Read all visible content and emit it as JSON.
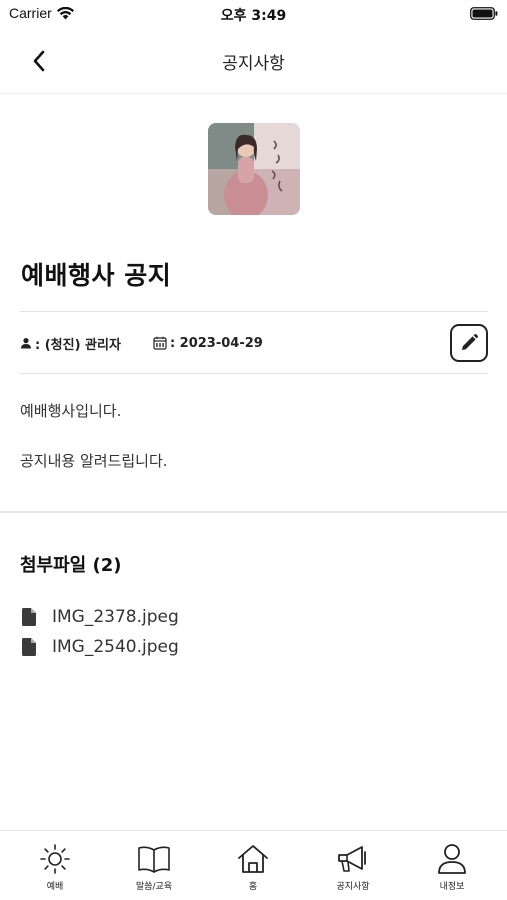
{
  "status_bar": {
    "carrier": "Carrier",
    "time": "오후 3:49"
  },
  "nav": {
    "title": "공지사항",
    "back_icon": "chevron-left-icon"
  },
  "post": {
    "title": "예배행사 공지",
    "author_label": ": (청진) 관리자",
    "date_label": ": 2023-04-29",
    "body_lines": [
      "예배행사입니다.",
      "공지내용 알려드립니다."
    ]
  },
  "attachments": {
    "heading": "첨부파일 (2)",
    "files": [
      "IMG_2378.jpeg",
      "IMG_2540.jpeg"
    ]
  },
  "tabs": [
    {
      "label": "예배",
      "icon": "sun-icon"
    },
    {
      "label": "말씀/교육",
      "icon": "book-icon"
    },
    {
      "label": "홈",
      "icon": "home-icon"
    },
    {
      "label": "공지사항",
      "icon": "megaphone-icon"
    },
    {
      "label": "내정보",
      "icon": "person-icon"
    }
  ]
}
